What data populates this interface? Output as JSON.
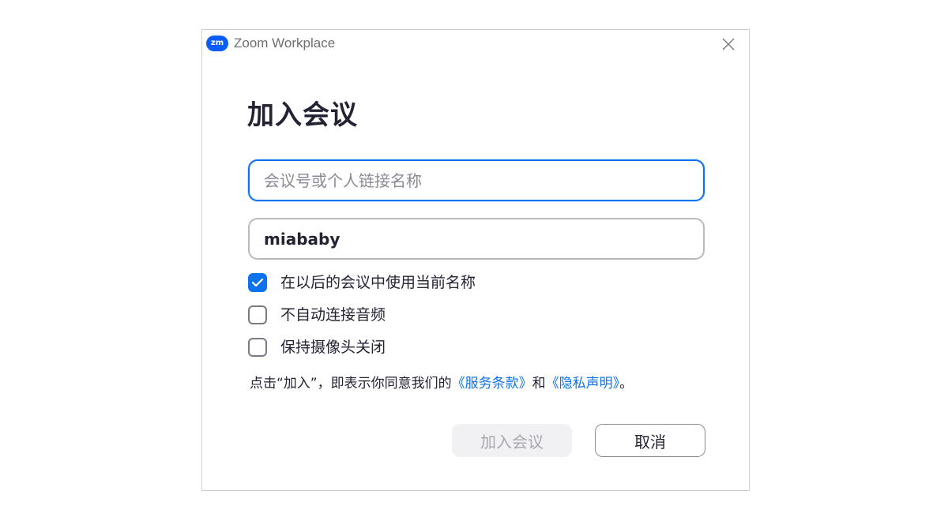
{
  "window": {
    "app_logo_text": "zm",
    "title": "Zoom Workplace",
    "close_icon": "close-icon"
  },
  "dialog": {
    "heading": "加入会议",
    "meeting_input": {
      "placeholder": "会议号或个人链接名称",
      "value": ""
    },
    "name_input": {
      "value": "miababy"
    },
    "options": [
      {
        "label": "在以后的会议中使用当前名称",
        "checked": true
      },
      {
        "label": "不自动连接音频",
        "checked": false
      },
      {
        "label": "保持摄像头关闭",
        "checked": false
      }
    ],
    "terms": {
      "prefix": "点击“加入”，即表示你同意我们的",
      "tos_link": "《服务条款》",
      "middle": "和",
      "privacy_link": "《隐私声明》",
      "suffix": "。"
    },
    "join_button": "加入会议",
    "cancel_button": "取消"
  },
  "colors": {
    "accent": "#0e72ed",
    "brand": "#0b5cff",
    "disabled_text": "#a8a8b0"
  }
}
